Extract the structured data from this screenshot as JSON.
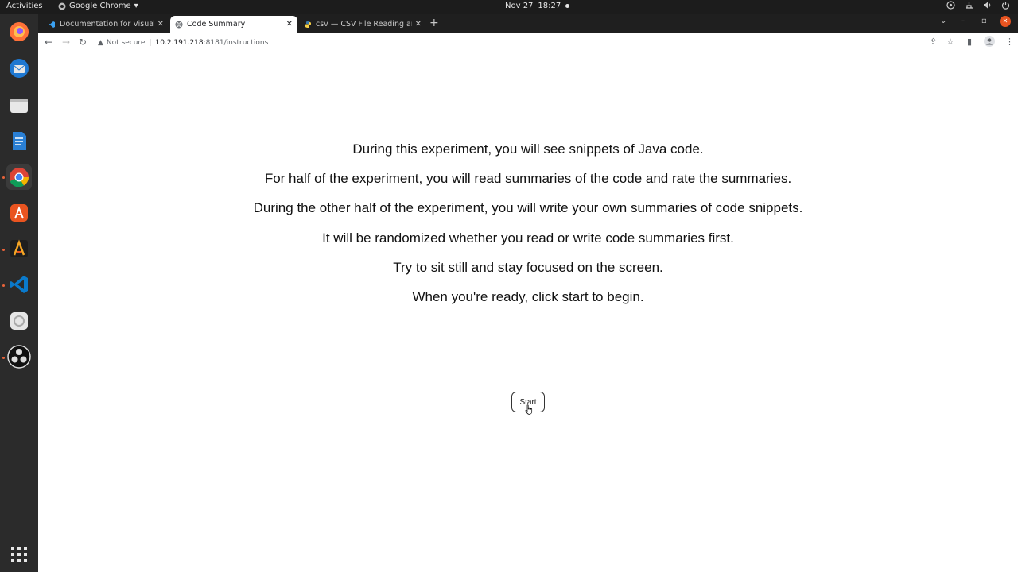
{
  "system_bar": {
    "activities": "Activities",
    "app_name": "Google Chrome",
    "date": "Nov 27",
    "time": "18:27"
  },
  "browser": {
    "tabs": [
      {
        "title": "Documentation for Visual",
        "icon": "vscode-icon",
        "active": false
      },
      {
        "title": "Code Summary",
        "icon": "globe-icon",
        "active": true
      },
      {
        "title": "csv — CSV File Reading an",
        "icon": "python-icon",
        "active": false
      }
    ],
    "address": {
      "security_label": "Not secure",
      "host": "10.2.191.218",
      "path": ":8181/instructions"
    }
  },
  "instructions": {
    "lines": [
      "During this experiment, you will see snippets of Java code.",
      "For half of the experiment, you will read summaries of the code and rate the summaries.",
      "During the other half of the experiment, you will write your own summaries of code snippets.",
      "It will be randomized whether you read or write code summaries first.",
      "Try to sit still and stay focused on the screen.",
      "When you're ready, click start to begin."
    ],
    "start_label": "Start"
  },
  "dock": {
    "apps": [
      "firefox-icon",
      "thunderbird-icon",
      "files-icon",
      "writer-icon",
      "chrome-icon",
      "app-center-icon",
      "alacritty-icon",
      "vscode-icon",
      "settings-icon",
      "obs-icon",
      "show-apps-icon"
    ]
  }
}
